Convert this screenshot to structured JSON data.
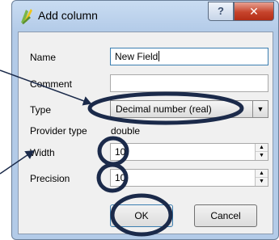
{
  "window": {
    "title": "Add column",
    "help_label": "?",
    "close_label": "✕"
  },
  "form": {
    "name_label": "Name",
    "name_value": "New Field",
    "comment_label": "Comment",
    "comment_value": "",
    "type_label": "Type",
    "type_value": "Decimal number (real)",
    "provider_label": "Provider type",
    "provider_value": "double",
    "width_label": "Width",
    "width_value": "10",
    "precision_label": "Precision",
    "precision_value": "10"
  },
  "buttons": {
    "ok_label": "OK",
    "cancel_label": "Cancel"
  },
  "colors": {
    "annotation": "#1b2a4a",
    "close_button": "#c6442c",
    "focus_border": "#3c7fb1"
  },
  "icons": [
    "qgis-logo-icon",
    "help-icon",
    "close-icon",
    "dropdown-arrow-icon",
    "spin-up-icon",
    "spin-down-icon"
  ]
}
